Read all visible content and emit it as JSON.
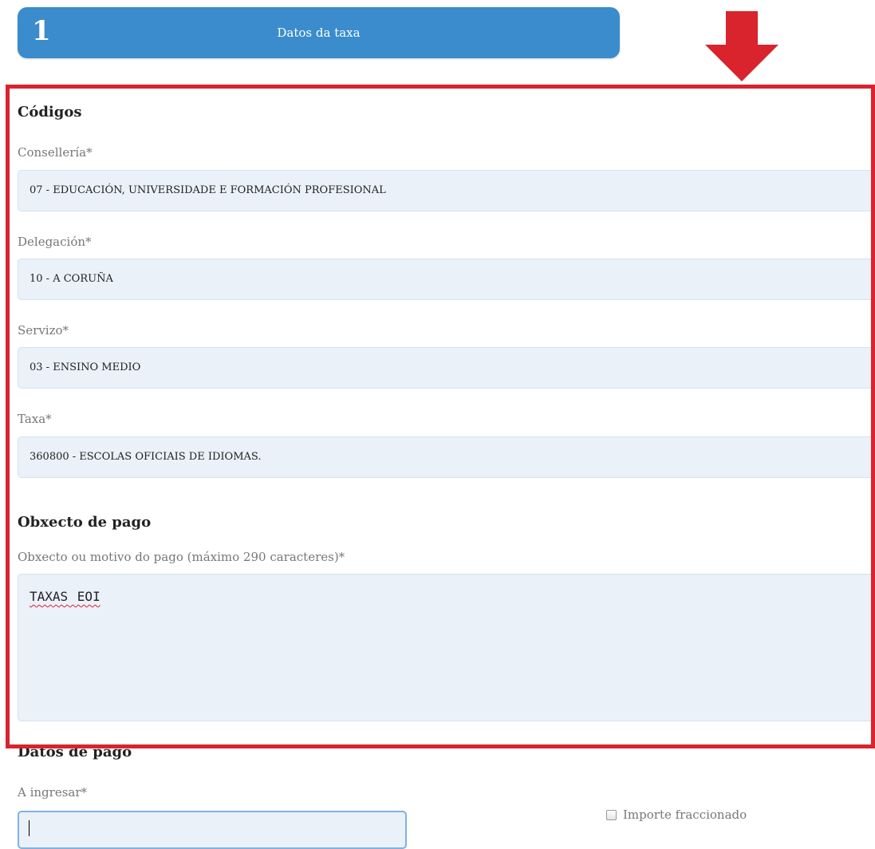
{
  "step": {
    "number": "1",
    "title": "Datos da taxa"
  },
  "codigos": {
    "heading": "Códigos",
    "fields": [
      {
        "label": "Consellería*",
        "value": "07 - EDUCACIÓN, UNIVERSIDADE E FORMACIÓN PROFESIONAL"
      },
      {
        "label": "Delegación*",
        "value": "10 - A CORUÑA"
      },
      {
        "label": "Servizo*",
        "value": "03 - ENSINO MEDIO"
      },
      {
        "label": "Taxa*",
        "value": "360800 - ESCOLAS OFICIAIS DE IDIOMAS."
      }
    ]
  },
  "obxecto": {
    "heading": "Obxecto de pago",
    "label": "Obxecto ou motivo do pago (máximo 290 caracteres)*",
    "value": "TAXAS EOI"
  },
  "datos_pago": {
    "heading": "Datos de pago",
    "amount_label": "A ingresar*",
    "amount_value": "",
    "fractional_label": "Importe fraccionado",
    "fractional_checked": false
  },
  "colors": {
    "header_blue": "#3a8ccc",
    "highlight_red": "#d9232d",
    "field_bg": "#eaf1f9"
  },
  "icons": {
    "annotation": "arrow-down-icon"
  }
}
